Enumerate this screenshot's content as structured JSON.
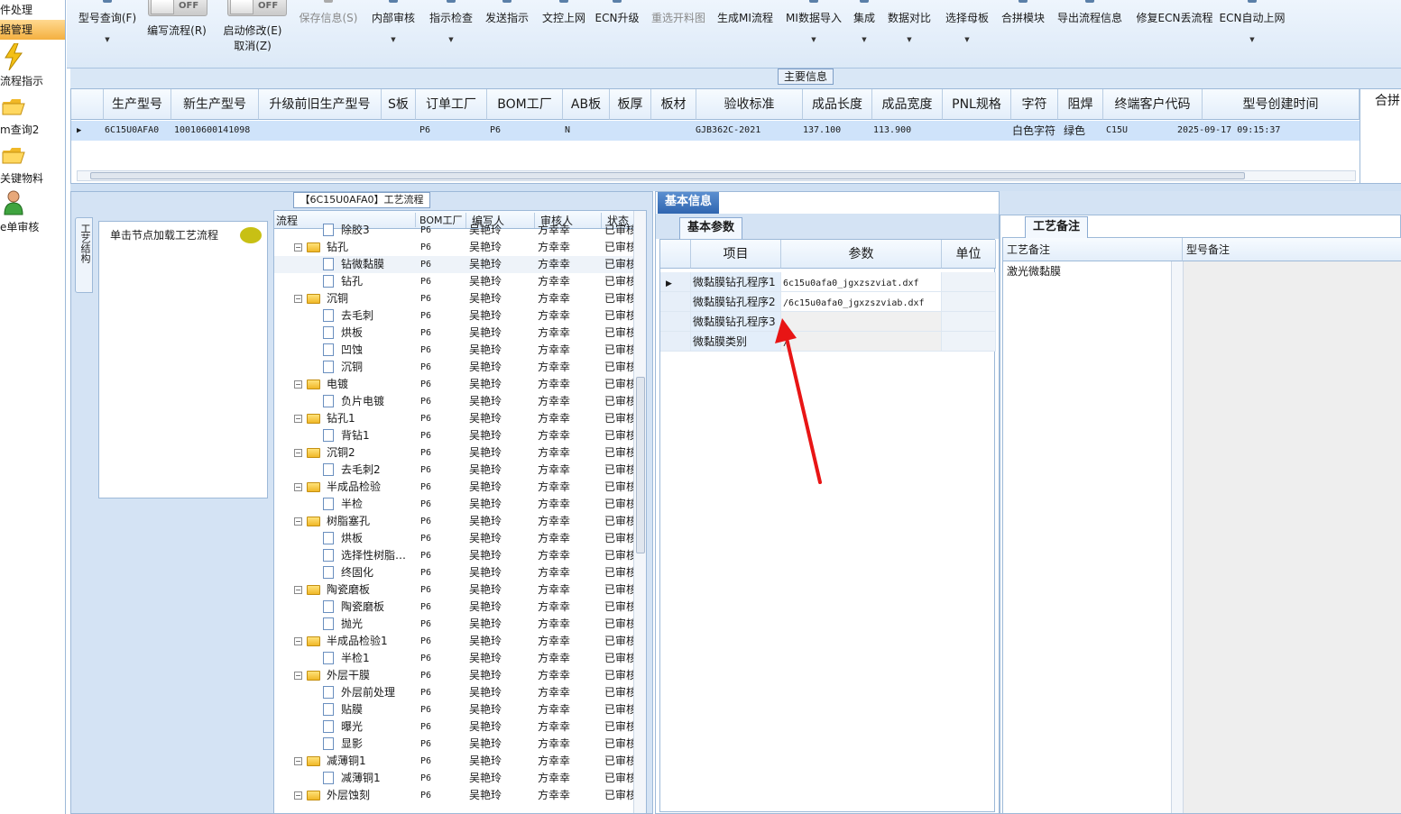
{
  "left_nav": {
    "items": [
      {
        "label": "件处理"
      },
      {
        "label": "据管理"
      },
      {
        "label": "流程指示"
      },
      {
        "label": "m查询2"
      },
      {
        "label": "关键物料"
      },
      {
        "label": "e单审核"
      }
    ]
  },
  "toolbar": {
    "model_query": "型号查询(F)",
    "toggle_off_1": "OFF",
    "write_flow": "编写流程(R)",
    "toggle_off_2": "OFF",
    "start_edit": "启动修改(E)",
    "cancel": "取消(Z)",
    "save_info": "保存信息(S)",
    "internal_review": "内部审核",
    "instruction_check": "指示检查",
    "send_instruction": "发送指示",
    "upload_doc": "文控上网",
    "ecn_upgrade": "ECN升级",
    "reselect_cut_chart": "重选开料图",
    "generate_mi_flow": "生成MI流程",
    "mi_data_import": "MI数据导入",
    "integrate": "集成",
    "data_compare": "数据对比",
    "select_master": "选择母板",
    "merge_module": "合拼模块",
    "export_flow_info": "导出流程信息",
    "fix_ecn_lost_flow": "修复ECN丢流程",
    "ecn_auto_upload": "ECN自动上网"
  },
  "main_info": {
    "title": "主要信息",
    "side_label": "合拼",
    "columns": [
      "生产型号",
      "新生产型号",
      "升级前旧生产型号",
      "S板",
      "订单工厂",
      "BOM工厂",
      "AB板",
      "板厚",
      "板材",
      "验收标准",
      "成品长度",
      "成品宽度",
      "PNL规格",
      "字符",
      "阻焊",
      "终端客户代码",
      "型号创建时间"
    ],
    "row": {
      "prod_model": "6C15U0AFA0",
      "new_model": "10010600141098",
      "old_model": "",
      "s_board": "",
      "order_factory": "P6",
      "bom_factory": "P6",
      "ab_board": "N",
      "thickness": "",
      "material": "",
      "acceptance": "GJB362C-2021",
      "length": "137.100",
      "width": "113.900",
      "pnl": "",
      "char": "白色字符",
      "solder": "绿色",
      "customer_code": "C15U",
      "created": "2025-09-17 09:15:37"
    }
  },
  "flow_panel": {
    "title": "【6C15U0AFA0】工艺流程",
    "side_tab": "工艺结构",
    "load_hint": "单击节点加载工艺流程",
    "columns": [
      "流程",
      "BOM工厂",
      "编写人",
      "审核人",
      "状态"
    ],
    "rows": [
      {
        "name": "除胶3",
        "type": "doc",
        "level": 2,
        "bom": "P6",
        "writer": "吴艳玲",
        "reviewer": "方幸幸",
        "status": "已审核"
      },
      {
        "name": "钻孔",
        "type": "folder",
        "level": 1,
        "bom": "P6",
        "writer": "吴艳玲",
        "reviewer": "方幸幸",
        "status": "已审核"
      },
      {
        "name": "钻微黏膜",
        "type": "doc",
        "level": 2,
        "bom": "P6",
        "writer": "吴艳玲",
        "reviewer": "方幸幸",
        "status": "已审核"
      },
      {
        "name": "钻孔",
        "type": "doc",
        "level": 2,
        "bom": "P6",
        "writer": "吴艳玲",
        "reviewer": "方幸幸",
        "status": "已审核"
      },
      {
        "name": "沉铜",
        "type": "folder",
        "level": 1,
        "bom": "P6",
        "writer": "吴艳玲",
        "reviewer": "方幸幸",
        "status": "已审核"
      },
      {
        "name": "去毛刺",
        "type": "doc",
        "level": 2,
        "bom": "P6",
        "writer": "吴艳玲",
        "reviewer": "方幸幸",
        "status": "已审核"
      },
      {
        "name": "烘板",
        "type": "doc",
        "level": 2,
        "bom": "P6",
        "writer": "吴艳玲",
        "reviewer": "方幸幸",
        "status": "已审核"
      },
      {
        "name": "凹蚀",
        "type": "doc",
        "level": 2,
        "bom": "P6",
        "writer": "吴艳玲",
        "reviewer": "方幸幸",
        "status": "已审核"
      },
      {
        "name": "沉铜",
        "type": "doc",
        "level": 2,
        "bom": "P6",
        "writer": "吴艳玲",
        "reviewer": "方幸幸",
        "status": "已审核"
      },
      {
        "name": "电镀",
        "type": "folder",
        "level": 1,
        "bom": "P6",
        "writer": "吴艳玲",
        "reviewer": "方幸幸",
        "status": "已审核"
      },
      {
        "name": "负片电镀",
        "type": "doc",
        "level": 2,
        "bom": "P6",
        "writer": "吴艳玲",
        "reviewer": "方幸幸",
        "status": "已审核"
      },
      {
        "name": "钻孔1",
        "type": "folder",
        "level": 1,
        "bom": "P6",
        "writer": "吴艳玲",
        "reviewer": "方幸幸",
        "status": "已审核"
      },
      {
        "name": "背钻1",
        "type": "doc",
        "level": 2,
        "bom": "P6",
        "writer": "吴艳玲",
        "reviewer": "方幸幸",
        "status": "已审核"
      },
      {
        "name": "沉铜2",
        "type": "folder",
        "level": 1,
        "bom": "P6",
        "writer": "吴艳玲",
        "reviewer": "方幸幸",
        "status": "已审核"
      },
      {
        "name": "去毛刺2",
        "type": "doc",
        "level": 2,
        "bom": "P6",
        "writer": "吴艳玲",
        "reviewer": "方幸幸",
        "status": "已审核"
      },
      {
        "name": "半成品检验",
        "type": "folder",
        "level": 1,
        "bom": "P6",
        "writer": "吴艳玲",
        "reviewer": "方幸幸",
        "status": "已审核"
      },
      {
        "name": "半检",
        "type": "doc",
        "level": 2,
        "bom": "P6",
        "writer": "吴艳玲",
        "reviewer": "方幸幸",
        "status": "已审核"
      },
      {
        "name": "树脂塞孔",
        "type": "folder",
        "level": 1,
        "bom": "P6",
        "writer": "吴艳玲",
        "reviewer": "方幸幸",
        "status": "已审核"
      },
      {
        "name": "烘板",
        "type": "doc",
        "level": 2,
        "bom": "P6",
        "writer": "吴艳玲",
        "reviewer": "方幸幸",
        "status": "已审核"
      },
      {
        "name": "选择性树脂…",
        "type": "doc",
        "level": 2,
        "bom": "P6",
        "writer": "吴艳玲",
        "reviewer": "方幸幸",
        "status": "已审核"
      },
      {
        "name": "终固化",
        "type": "doc",
        "level": 2,
        "bom": "P6",
        "writer": "吴艳玲",
        "reviewer": "方幸幸",
        "status": "已审核"
      },
      {
        "name": "陶瓷磨板",
        "type": "folder",
        "level": 1,
        "bom": "P6",
        "writer": "吴艳玲",
        "reviewer": "方幸幸",
        "status": "已审核"
      },
      {
        "name": "陶瓷磨板",
        "type": "doc",
        "level": 2,
        "bom": "P6",
        "writer": "吴艳玲",
        "reviewer": "方幸幸",
        "status": "已审核"
      },
      {
        "name": "抛光",
        "type": "doc",
        "level": 2,
        "bom": "P6",
        "writer": "吴艳玲",
        "reviewer": "方幸幸",
        "status": "已审核"
      },
      {
        "name": "半成品检验1",
        "type": "folder",
        "level": 1,
        "bom": "P6",
        "writer": "吴艳玲",
        "reviewer": "方幸幸",
        "status": "已审核"
      },
      {
        "name": "半检1",
        "type": "doc",
        "level": 2,
        "bom": "P6",
        "writer": "吴艳玲",
        "reviewer": "方幸幸",
        "status": "已审核"
      },
      {
        "name": "外层干膜",
        "type": "folder",
        "level": 1,
        "bom": "P6",
        "writer": "吴艳玲",
        "reviewer": "方幸幸",
        "status": "已审核"
      },
      {
        "name": "外层前处理",
        "type": "doc",
        "level": 2,
        "bom": "P6",
        "writer": "吴艳玲",
        "reviewer": "方幸幸",
        "status": "已审核"
      },
      {
        "name": "贴膜",
        "type": "doc",
        "level": 2,
        "bom": "P6",
        "writer": "吴艳玲",
        "reviewer": "方幸幸",
        "status": "已审核"
      },
      {
        "name": "曝光",
        "type": "doc",
        "level": 2,
        "bom": "P6",
        "writer": "吴艳玲",
        "reviewer": "方幸幸",
        "status": "已审核"
      },
      {
        "name": "显影",
        "type": "doc",
        "level": 2,
        "bom": "P6",
        "writer": "吴艳玲",
        "reviewer": "方幸幸",
        "status": "已审核"
      },
      {
        "name": "减薄铜1",
        "type": "folder",
        "level": 1,
        "bom": "P6",
        "writer": "吴艳玲",
        "reviewer": "方幸幸",
        "status": "已审核"
      },
      {
        "name": "减薄铜1",
        "type": "doc",
        "level": 2,
        "bom": "P6",
        "writer": "吴艳玲",
        "reviewer": "方幸幸",
        "status": "已审核"
      },
      {
        "name": "外层蚀刻",
        "type": "folder",
        "level": 1,
        "bom": "P6",
        "writer": "吴艳玲",
        "reviewer": "方幸幸",
        "status": "已审核"
      }
    ]
  },
  "basic_info": {
    "tab": "基本信息",
    "sub_tab": "基本参数",
    "columns": [
      "项目",
      "参数",
      "单位"
    ],
    "rows": [
      {
        "item": "微黏膜钻孔程序1",
        "param": "6c15u0afa0_jgxzszviat.dxf",
        "unit": ""
      },
      {
        "item": "微黏膜钻孔程序2",
        "param": "/6c15u0afa0_jgxzszviab.dxf",
        "unit": ""
      },
      {
        "item": "微黏膜钻孔程序3",
        "param": "",
        "unit": ""
      },
      {
        "item": "微黏膜类别",
        "param": "/",
        "unit": ""
      }
    ]
  },
  "remarks": {
    "tab": "工艺备注",
    "col_process": "工艺备注",
    "col_model": "型号备注",
    "process_text": "激光微黏膜",
    "model_text": ""
  }
}
